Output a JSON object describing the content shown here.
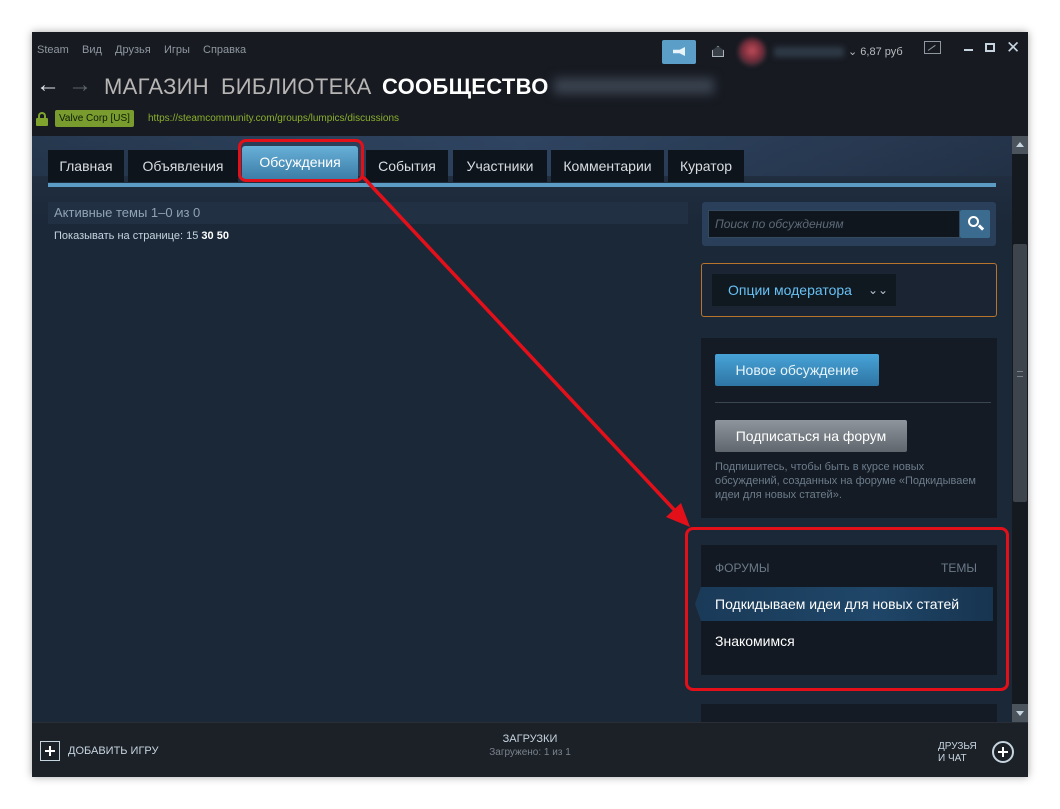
{
  "menu": {
    "items": [
      "Steam",
      "Вид",
      "Друзья",
      "Игры",
      "Справка"
    ]
  },
  "account": {
    "balance": "6,87 руб"
  },
  "nav": {
    "store": "МАГАЗИН",
    "library": "БИБЛИОТЕКА",
    "community": "СООБЩЕСТВО"
  },
  "urlbar": {
    "cert": "Valve Corp [US]",
    "url": "https://steamcommunity.com/groups/lumpics/discussions"
  },
  "tabs": [
    {
      "label": "Главная"
    },
    {
      "label": "Объявления"
    },
    {
      "label": "Обсуждения"
    },
    {
      "label": "События"
    },
    {
      "label": "Участники"
    },
    {
      "label": "Комментарии"
    },
    {
      "label": "Куратор"
    }
  ],
  "main": {
    "active_themes": "Активные темы 1–0 из 0",
    "per_page_label": "Показывать на странице: 15",
    "per_page_30": "30",
    "per_page_50": "50"
  },
  "sidebar": {
    "search_placeholder": "Поиск по обсуждениям",
    "mod_options": "Опции модератора",
    "new_discussion": "Новое обсуждение",
    "subscribe": "Подписаться на форум",
    "subscribe_desc": "Подпишитесь, чтобы быть в курсе новых обсуждений, созданных на форуме «Подкидываем идеи для новых статей».",
    "forums_header": "ФОРУМЫ",
    "topics_header": "ТЕМЫ",
    "forums": [
      {
        "label": "Подкидываем идеи для новых статей"
      },
      {
        "label": "Знакомимся"
      }
    ]
  },
  "bottom": {
    "add_game": "ДОБАВИТЬ ИГРУ",
    "downloads": "ЗАГРУЗКИ",
    "downloads_status": "Загружено: 1 из 1",
    "friends_line1": "ДРУЗЬЯ",
    "friends_line2": "И ЧАТ"
  },
  "colors": {
    "accent": "#67c1f5",
    "annotation": "#e3101a",
    "background": "#1b2838"
  },
  "icons": {
    "back": "arrow-left-icon",
    "forward": "arrow-right-icon",
    "lock": "lock-icon",
    "search": "search-icon"
  }
}
